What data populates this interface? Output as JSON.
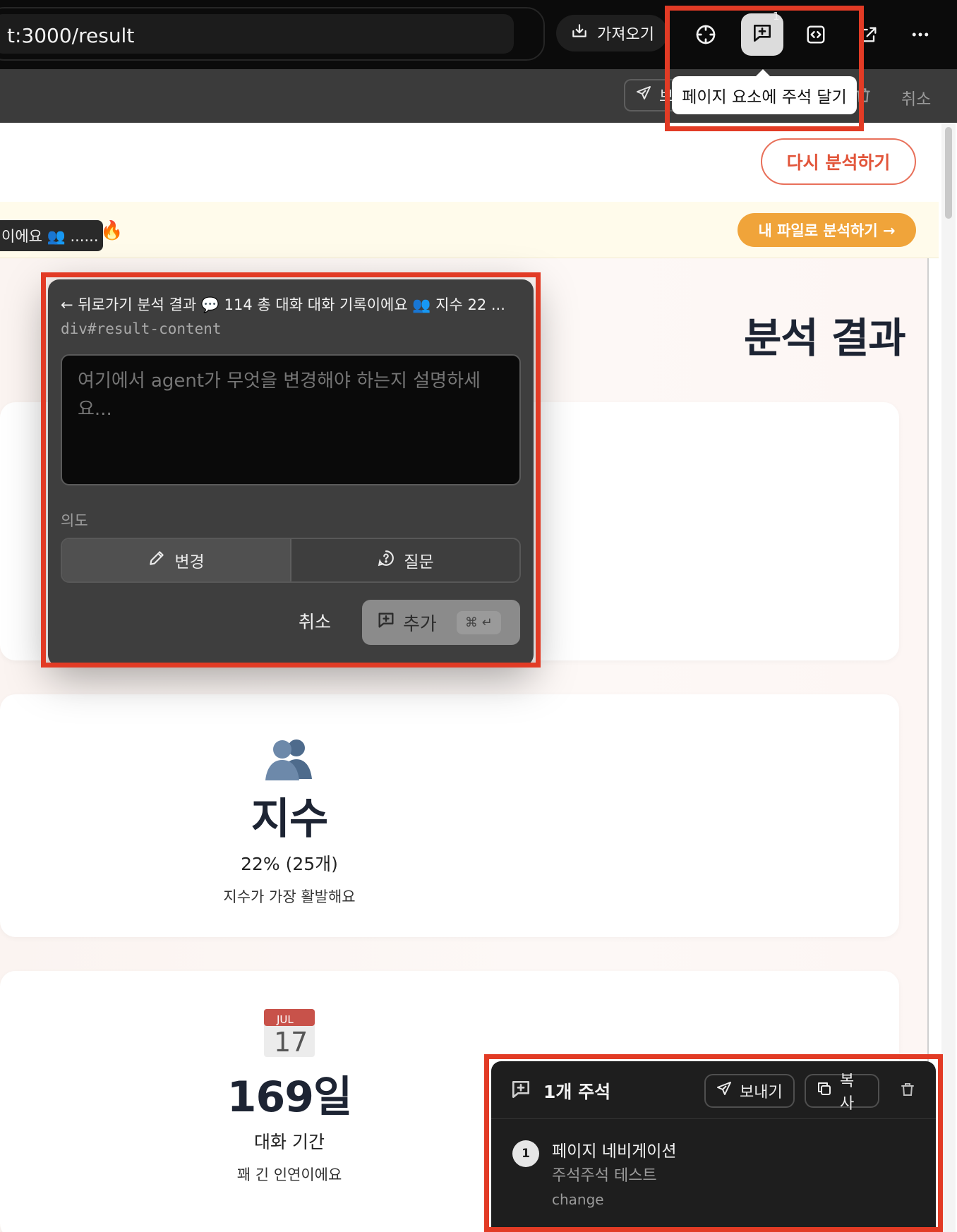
{
  "browser": {
    "url": "t:3000/result",
    "import_label": "가져오기",
    "annotation_count": "1",
    "tooltip": "페이지 요소에 주석 달기"
  },
  "toolbar2": {
    "send_partial": "보",
    "cancel": "취소"
  },
  "page": {
    "reanalyze_button": "다시 분석하기",
    "banner_pill": "이에요 👥 ......",
    "banner_emoji": "🔥",
    "my_file_button": "내 파일로 분석하기 →",
    "result_title": "분석 결과",
    "stats": [
      {
        "emoji": "👥",
        "title": "지수",
        "value": "22% (25개)",
        "desc": "지수가 가장 활발해요"
      },
      {
        "emoji": "📅",
        "calendar_month": "JUL",
        "calendar_day": "17",
        "title": "169일",
        "value": "대화 기간",
        "desc": "꽤 긴 인연이에요"
      }
    ]
  },
  "popup": {
    "breadcrumb": "← 뒤로가기 분석 결과 💬 114 총 대화 대화 기록이에요 👥 지수 22 ...",
    "selector": "div#result-content",
    "placeholder": "여기에서 agent가 무엇을 변경해야 하는지 설명하세요...",
    "intent_label": "의도",
    "intent_change": "변경",
    "intent_question": "질문",
    "cancel": "취소",
    "add": "추가",
    "shortcut": "⌘ ↵"
  },
  "notes": {
    "title": "1개 주석",
    "send": "보내기",
    "copy": "복사",
    "items": [
      {
        "number": "1",
        "title": "페이지 네비게이션",
        "text": "주석주석 테스트",
        "tag": "change"
      }
    ]
  },
  "colors": {
    "highlight": "#e23b25",
    "accent_orange": "#f0a43a",
    "reanalyze_red": "#e2553a"
  }
}
